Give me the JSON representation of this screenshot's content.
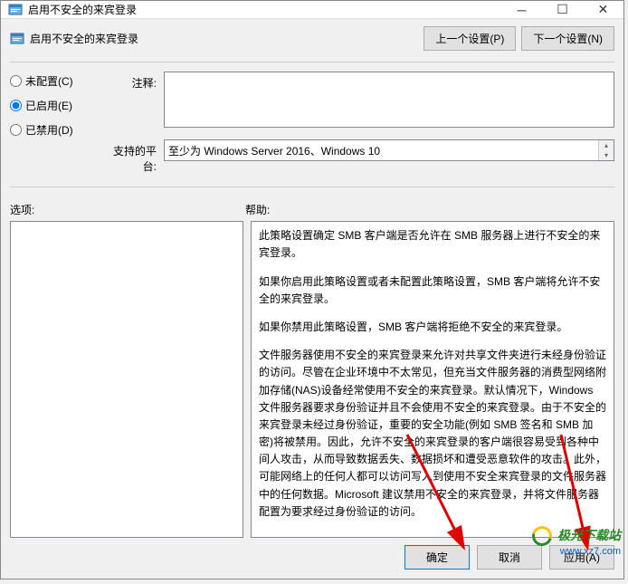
{
  "titlebar": {
    "title": "启用不安全的来宾登录"
  },
  "header": {
    "title": "启用不安全的来宾登录",
    "prev_btn": "上一个设置(P)",
    "next_btn": "下一个设置(N)"
  },
  "radios": {
    "not_configured": "未配置(C)",
    "enabled": "已启用(E)",
    "disabled": "已禁用(D)",
    "selected": "enabled"
  },
  "labels": {
    "comment": "注释:",
    "platform": "支持的平台:",
    "options": "选项:",
    "help": "帮助:"
  },
  "fields": {
    "comment_value": "",
    "platform_value": "至少为 Windows Server 2016、Windows 10"
  },
  "help_text": {
    "p1": "此策略设置确定 SMB 客户端是否允许在 SMB 服务器上进行不安全的来宾登录。",
    "p2": "如果你启用此策略设置或者未配置此策略设置，SMB 客户端将允许不安全的来宾登录。",
    "p3": "如果你禁用此策略设置，SMB 客户端将拒绝不安全的来宾登录。",
    "p4": "文件服务器使用不安全的来宾登录来允许对共享文件夹进行未经身份验证的访问。尽管在企业环境中不太常见，但充当文件服务器的消费型网络附加存储(NAS)设备经常使用不安全的来宾登录。默认情况下，Windows 文件服务器要求身份验证并且不会使用不安全的来宾登录。由于不安全的来宾登录未经过身份验证，重要的安全功能(例如 SMB 签名和 SMB 加密)将被禁用。因此，允许不安全的来宾登录的客户端很容易受到各种中间人攻击，从而导致数据丢失、数据损坏和遭受恶意软件的攻击。此外，可能网络上的任何人都可以访问写入到使用不安全来宾登录的文件服务器中的任何数据。Microsoft 建议禁用不安全的来宾登录，并将文件服务器配置为要求经过身份验证的访问。"
  },
  "footer": {
    "ok": "确定",
    "cancel": "取消",
    "apply": "应用(A)"
  },
  "watermark": {
    "text": "极光下载站",
    "url": "www.xz7.com"
  }
}
